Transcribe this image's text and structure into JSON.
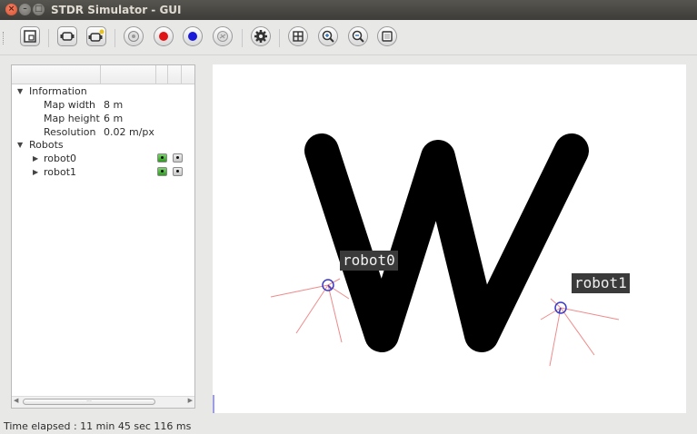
{
  "window": {
    "title": "STDR Simulator - GUI",
    "close_glyph": "×",
    "min_glyph": "–",
    "max_glyph": "□"
  },
  "toolbar": {
    "buttons": [
      {
        "icon": "load-map-icon"
      },
      {
        "icon": "add-robot-icon"
      },
      {
        "icon": "add-robot-plus-icon"
      },
      {
        "icon": "add-sensor-icon"
      },
      {
        "icon": "record-red-icon"
      },
      {
        "icon": "record-blue-icon"
      },
      {
        "icon": "rfid-icon"
      },
      {
        "icon": "properties-gear-icon"
      },
      {
        "icon": "grid-icon"
      },
      {
        "icon": "zoom-in-icon"
      },
      {
        "icon": "zoom-out-icon"
      },
      {
        "icon": "fit-window-icon"
      }
    ]
  },
  "tree": {
    "information": {
      "label": "Information",
      "rows": [
        {
          "key": "Map width",
          "value": "8 m"
        },
        {
          "key": "Map height",
          "value": "6 m"
        },
        {
          "key": "Resolution",
          "value": "0.02 m/px"
        }
      ]
    },
    "robots": {
      "label": "Robots",
      "items": [
        {
          "name": "robot0"
        },
        {
          "name": "robot1"
        }
      ]
    }
  },
  "canvas": {
    "map_letter": "W",
    "robot_labels": [
      "robot0",
      "robot1"
    ]
  },
  "status": {
    "text": "Time elapsed : 11 min 45 sec 116 ms"
  },
  "colors": {
    "laser": "#f08a8a",
    "robot": "#3b3bc8",
    "map": "#000000"
  }
}
